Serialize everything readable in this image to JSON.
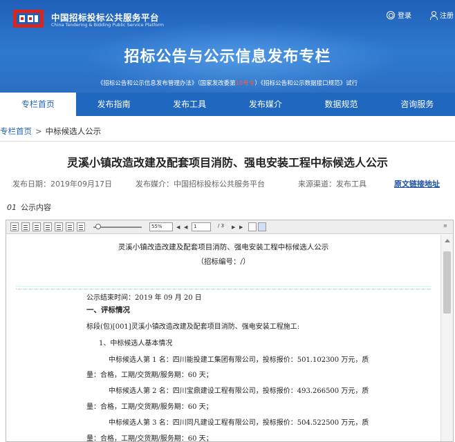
{
  "header": {
    "brand_cn": "中国招标投标公共服务平台",
    "brand_en": "China Tendering & Bidding Public Service Platform",
    "login_label": "登录",
    "register_label": "注册",
    "title": "招标公告与公示信息发布专栏",
    "subtitle_part1": "《招标公告和公示信息发布管理办法》（国家发改委第",
    "subtitle_red": "10号令",
    "subtitle_part2": "）《招标公告和公示数据接口规范》试行",
    "colors": {
      "banner": "#2f79cf",
      "nav": "#1f67bf",
      "accent_red": "#ff5a4d"
    }
  },
  "nav": {
    "items": [
      {
        "label": "专栏首页",
        "active": true
      },
      {
        "label": "发布指南",
        "active": false
      },
      {
        "label": "发布工具",
        "active": false
      },
      {
        "label": "发布媒介",
        "active": false
      },
      {
        "label": "数据规范",
        "active": false
      },
      {
        "label": "咨询服务",
        "active": false
      }
    ]
  },
  "breadcrumb": {
    "home": "专栏首页",
    "separator": ">",
    "current": "中标候选人公示"
  },
  "notice": {
    "title": "灵溪小镇改造改建及配套项目消防、强电安装工程中标候选人公示",
    "date": "发布日期：2019年09月17日",
    "media": "发布媒介：中国招标投标公共服务平台",
    "source": "来源渠道：发布工具",
    "link": "原文链接地址"
  },
  "section": {
    "num": "01",
    "label": "公示内容"
  },
  "viewer": {
    "zoom": "55%",
    "page_current": "1",
    "page_total": "/ 3",
    "icons": [
      "first-page-icon",
      "prev-page-icon",
      "next-page-icon",
      "last-page-icon",
      "select-text-icon",
      "hand-tool-icon"
    ]
  },
  "document": {
    "title": "灵溪小镇改造改建及配套项目消防、强电安装工程中标候选人公示",
    "number": "（招标编号：/）",
    "end_time": "公示结束时间：2019 年 09 月 20 日",
    "heading1": "一、评标情况",
    "lot": "标段(包)[001]灵溪小镇改造改建及配套项目消防、强电安装工程施工:",
    "sub1": "1、中标候选人基本情况",
    "c1a": "中标候选人第 1 名：四川能投建工集团有限公司，投标报价：501.102300 万元，质",
    "c1b": "量：合格，工期/交货期/服务期：60 天；",
    "c2a": "中标候选人第 2 名：四川宝鼎建设工程有限公司，投标报价：493.266500 万元，质",
    "c2b": "量：合格，工期/交货期/服务期：60 天；",
    "c3a": "中标候选人第 3 名：四川同凡建设工程有限公司，投标报价：504.522500 万元，质",
    "c3b": "量：合格，工期/交货期/服务期：60 天；"
  }
}
